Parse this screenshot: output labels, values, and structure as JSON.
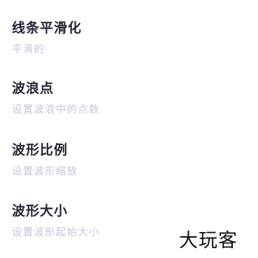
{
  "settings": {
    "items": [
      {
        "title": "线条平滑化",
        "description": "平滑的"
      },
      {
        "title": "波浪点",
        "description": "设置波浪中的点数"
      },
      {
        "title": "波形比例",
        "description": "设置波形缩放"
      },
      {
        "title": "波形大小",
        "description": "设置波形起始大小"
      }
    ]
  },
  "watermark": {
    "text": "大玩客"
  },
  "colors": {
    "title": "#252535",
    "description": "#c3c6dc",
    "background": "#ffffff"
  }
}
